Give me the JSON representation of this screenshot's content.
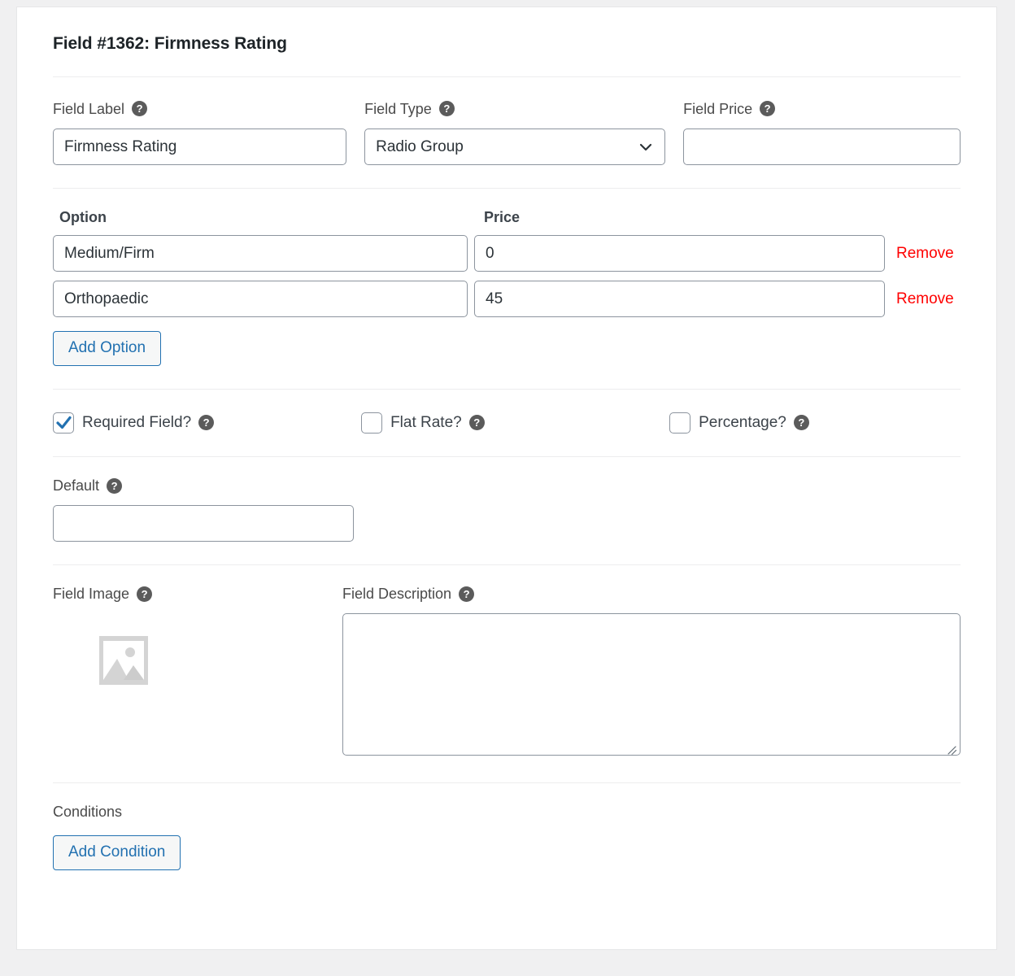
{
  "panel": {
    "title": "Field #1362: Firmness Rating"
  },
  "form": {
    "field_label": {
      "label": "Field Label",
      "help": "?",
      "value": "Firmness Rating",
      "placeholder": ""
    },
    "field_type": {
      "label": "Field Type",
      "help": "?",
      "value": "Radio Group",
      "options": [
        "Radio Group"
      ],
      "chevron_icon": "chevron-down-icon"
    },
    "field_price": {
      "label": "Field Price",
      "help": "?",
      "value": "",
      "placeholder": ""
    }
  },
  "options_table": {
    "headers": {
      "option": "Option",
      "price": "Price"
    },
    "rows": [
      {
        "option": "Medium/Firm",
        "price": "0",
        "remove_label": "Remove"
      },
      {
        "option": "Orthopaedic",
        "price": "45",
        "remove_label": "Remove"
      }
    ],
    "add_option_label": "Add Option"
  },
  "checkboxes": [
    {
      "label": "Required Field?",
      "checked": true,
      "help": "?"
    },
    {
      "label": "Flat Rate?",
      "checked": false,
      "help": "?"
    },
    {
      "label": "Percentage?",
      "checked": false,
      "help": "?"
    }
  ],
  "default_field": {
    "label": "Default",
    "help": "?",
    "value": "",
    "placeholder": ""
  },
  "field_image": {
    "label": "Field Image",
    "help": "?",
    "placeholder_icon": "image-placeholder-icon"
  },
  "field_description": {
    "label": "Field Description",
    "help": "?",
    "value": "",
    "placeholder": ""
  },
  "conditions": {
    "label": "Conditions",
    "add_condition_label": "Add Condition"
  },
  "colors": {
    "accent_blue": "#2271b1",
    "remove_red": "#ff0000",
    "text_dark": "#1d2327",
    "text_body": "#3c434a",
    "border_gray": "#8c949e",
    "page_bg": "#f0f0f1",
    "button_bg": "#f6f7f7"
  }
}
